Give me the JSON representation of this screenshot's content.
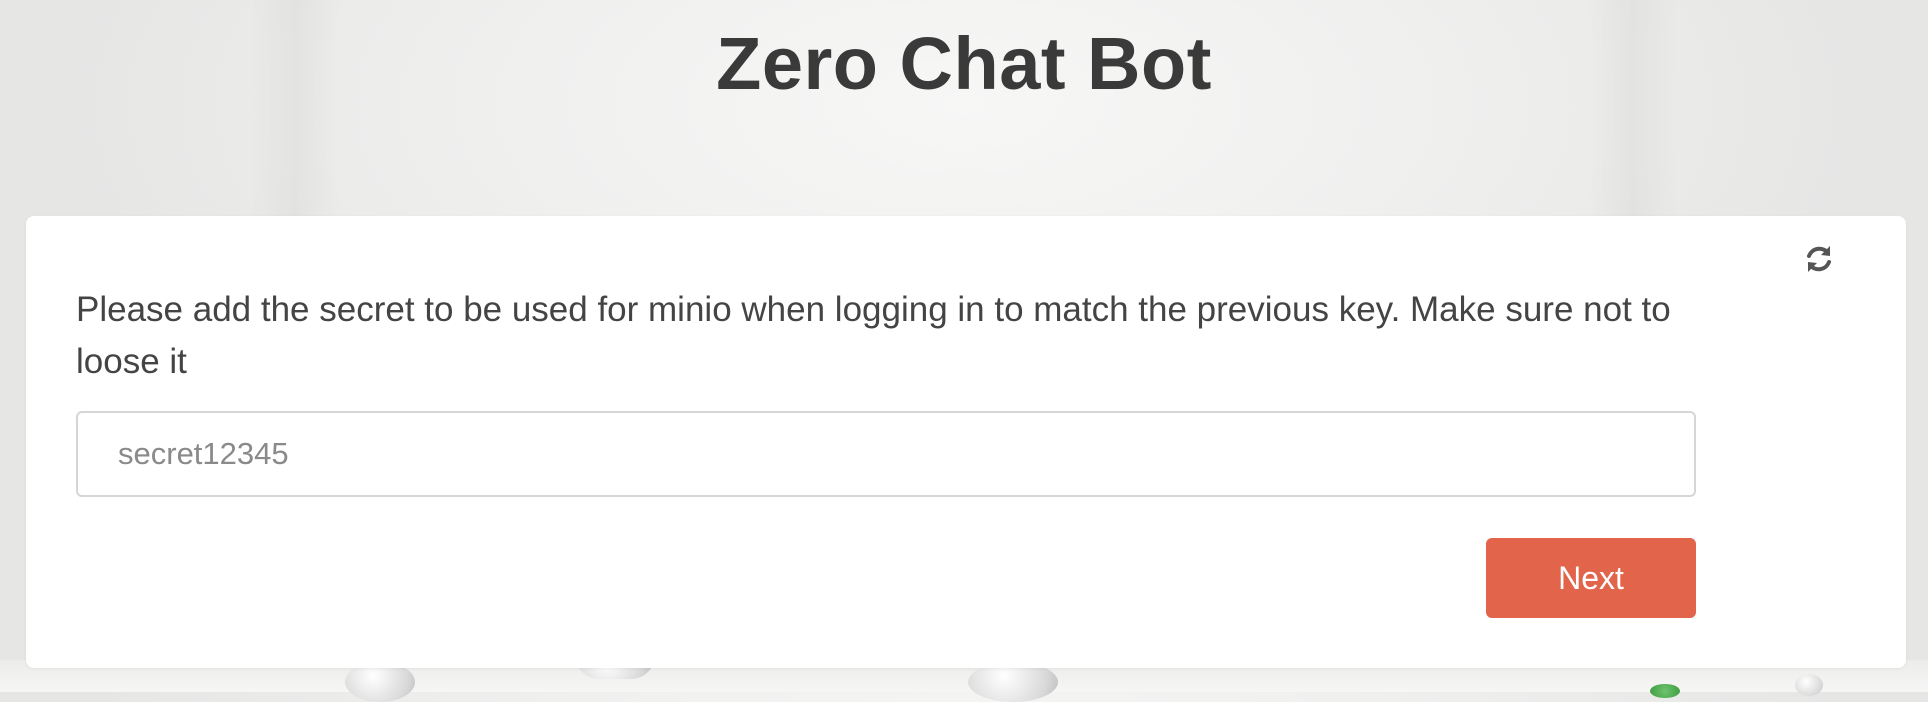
{
  "app": {
    "title": "Zero Chat Bot"
  },
  "setup_step": {
    "prompt": "Please add the secret to be used for minio when logging in to match the previous key. Make sure not to loose it",
    "secret_input": {
      "value": "",
      "placeholder": "secret12345"
    },
    "next_label": "Next",
    "refresh_icon": "refresh-icon"
  },
  "theme": {
    "accent": "#e2644a",
    "title_color": "#3a3a3a",
    "icon_color": "#555555"
  }
}
